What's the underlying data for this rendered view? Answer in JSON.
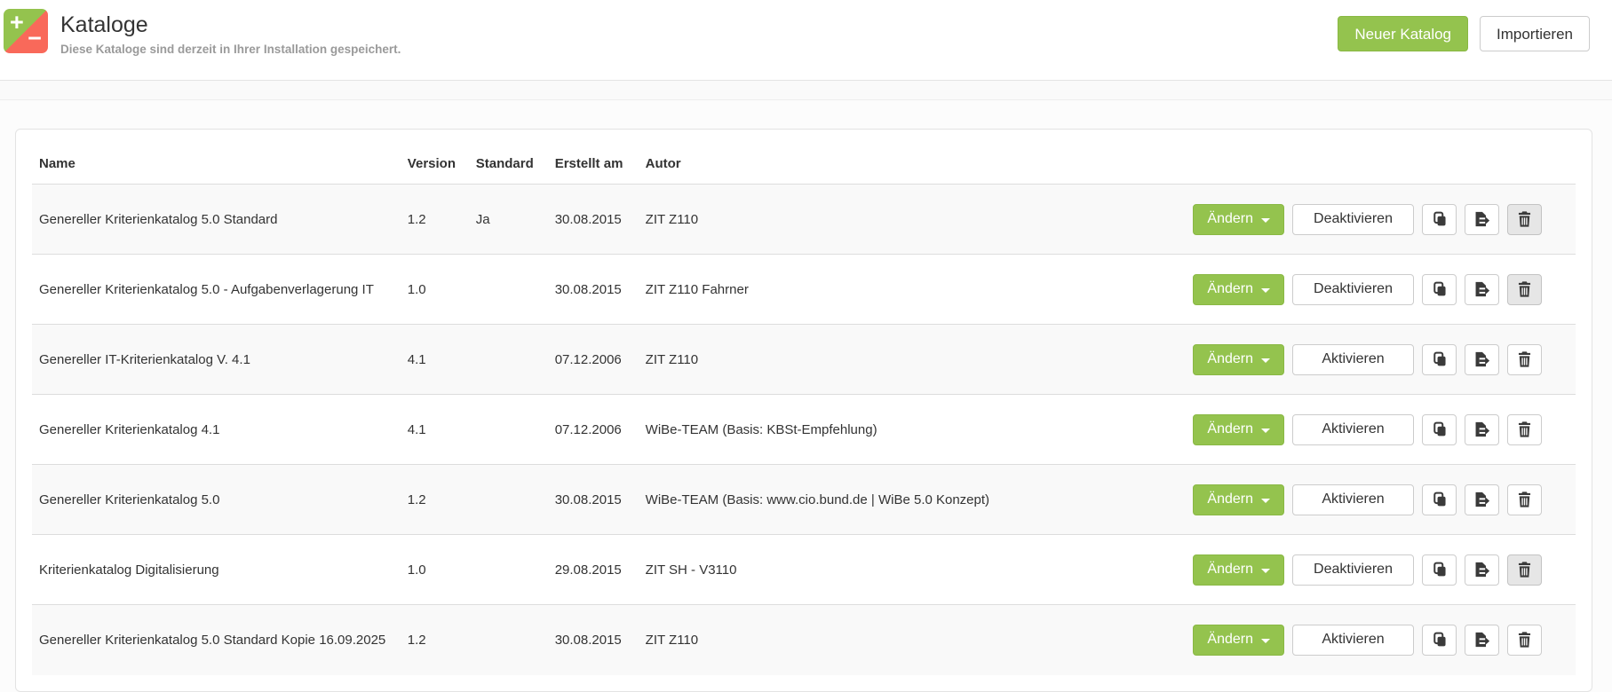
{
  "header": {
    "title": "Kataloge",
    "subtitle": "Diese Kataloge sind derzeit in Ihrer Installation gespeichert.",
    "logo": {
      "plus_glyph": "+",
      "minus_glyph": "−"
    },
    "buttons": {
      "new_catalog": "Neuer Katalog",
      "import": "Importieren"
    }
  },
  "colors": {
    "accent_green": "#94c34e",
    "logo_red": "#f9695a",
    "row_stripe": "#f9f9f9",
    "border_grey": "#dddddd",
    "disabled_button_grey": "#e6e6e6"
  },
  "table": {
    "columns": [
      "Name",
      "Version",
      "Standard",
      "Erstellt am",
      "Autor"
    ],
    "actions": {
      "change_label": "Ändern",
      "copy_icon": "copy-icon",
      "export_icon": "file-export-icon",
      "delete_icon": "trash-icon"
    },
    "rows": [
      {
        "name": "Genereller Kriterienkatalog 5.0 Standard",
        "version": "1.2",
        "standard": "Ja",
        "created": "30.08.2015",
        "author": "ZIT Z110",
        "toggle": "Deaktivieren",
        "delete_disabled": true
      },
      {
        "name": "Genereller Kriterienkatalog 5.0 - Aufgabenverlagerung IT",
        "version": "1.0",
        "standard": "",
        "created": "30.08.2015",
        "author": "ZIT Z110 Fahrner",
        "toggle": "Deaktivieren",
        "delete_disabled": true
      },
      {
        "name": "Genereller IT-Kriterienkatalog V. 4.1",
        "version": "4.1",
        "standard": "",
        "created": "07.12.2006",
        "author": "ZIT Z110",
        "toggle": "Aktivieren",
        "delete_disabled": false
      },
      {
        "name": "Genereller Kriterienkatalog 4.1",
        "version": "4.1",
        "standard": "",
        "created": "07.12.2006",
        "author": "WiBe-TEAM (Basis: KBSt-Empfehlung)",
        "toggle": "Aktivieren",
        "delete_disabled": false
      },
      {
        "name": "Genereller Kriterienkatalog 5.0",
        "version": "1.2",
        "standard": "",
        "created": "30.08.2015",
        "author": "WiBe-TEAM (Basis: www.cio.bund.de | WiBe 5.0 Konzept)",
        "toggle": "Aktivieren",
        "delete_disabled": false
      },
      {
        "name": "Kriterienkatalog Digitalisierung",
        "version": "1.0",
        "standard": "",
        "created": "29.08.2015",
        "author": "ZIT SH - V3110",
        "toggle": "Deaktivieren",
        "delete_disabled": true
      },
      {
        "name": "Genereller Kriterienkatalog 5.0 Standard Kopie 16.09.2025",
        "version": "1.2",
        "standard": "",
        "created": "30.08.2015",
        "author": "ZIT Z110",
        "toggle": "Aktivieren",
        "delete_disabled": false
      }
    ]
  }
}
